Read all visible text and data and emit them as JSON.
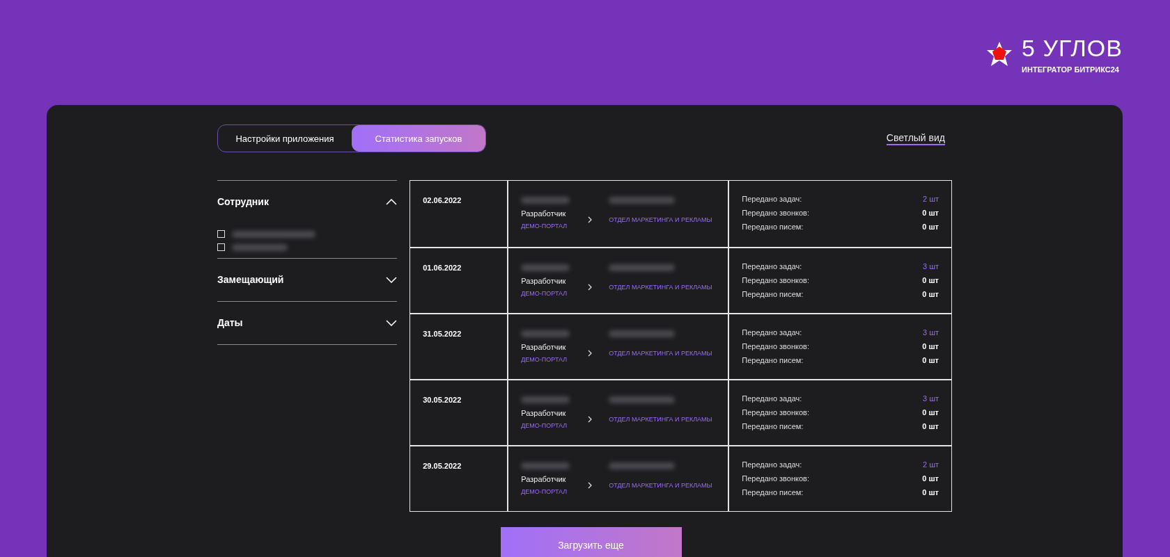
{
  "logo": {
    "title": "5 УГЛОВ",
    "subtitle": "ИНТЕГРАТОР БИТРИКС24"
  },
  "tabs": [
    {
      "label": "Настройки приложения",
      "selected": false
    },
    {
      "label": "Статистика запусков",
      "selected": true
    }
  ],
  "theme_link": "Светлый вид",
  "filters": [
    {
      "title": "Сотрудник",
      "expanded": true,
      "options": [
        {
          "checked": false
        },
        {
          "checked": false
        }
      ]
    },
    {
      "title": "Замещающий",
      "expanded": false
    },
    {
      "title": "Даты",
      "expanded": false
    }
  ],
  "rows": [
    {
      "date": "02.06.2022",
      "role": "Разработчик",
      "portal": "ДЕМО-ПОРТАЛ",
      "department": "ОТДЕЛ МАРКЕТИНГА И РЕКЛАМЫ",
      "stats": [
        {
          "label": "Передано задач:",
          "value": "2 шт",
          "highlighted": true
        },
        {
          "label": "Передано звонков:",
          "value": "0 шт",
          "highlighted": false
        },
        {
          "label": "Передано писем:",
          "value": "0 шт",
          "highlighted": false
        }
      ]
    },
    {
      "date": "01.06.2022",
      "role": "Разработчик",
      "portal": "ДЕМО-ПОРТАЛ",
      "department": "ОТДЕЛ МАРКЕТИНГА И РЕКЛАМЫ",
      "stats": [
        {
          "label": "Передано задач:",
          "value": "3 шт",
          "highlighted": true
        },
        {
          "label": "Передано звонков:",
          "value": "0 шт",
          "highlighted": false
        },
        {
          "label": "Передано писем:",
          "value": "0 шт",
          "highlighted": false
        }
      ]
    },
    {
      "date": "31.05.2022",
      "role": "Разработчик",
      "portal": "ДЕМО-ПОРТАЛ",
      "department": "ОТДЕЛ МАРКЕТИНГА И РЕКЛАМЫ",
      "stats": [
        {
          "label": "Передано задач:",
          "value": "3 шт",
          "highlighted": true
        },
        {
          "label": "Передано звонков:",
          "value": "0 шт",
          "highlighted": false
        },
        {
          "label": "Передано писем:",
          "value": "0 шт",
          "highlighted": false
        }
      ]
    },
    {
      "date": "30.05.2022",
      "role": "Разработчик",
      "portal": "ДЕМО-ПОРТАЛ",
      "department": "ОТДЕЛ МАРКЕТИНГА И РЕКЛАМЫ",
      "stats": [
        {
          "label": "Передано задач:",
          "value": "3 шт",
          "highlighted": true
        },
        {
          "label": "Передано звонков:",
          "value": "0 шт",
          "highlighted": false
        },
        {
          "label": "Передано писем:",
          "value": "0 шт",
          "highlighted": false
        }
      ]
    },
    {
      "date": "29.05.2022",
      "role": "Разработчик",
      "portal": "ДЕМО-ПОРТАЛ",
      "department": "ОТДЕЛ МАРКЕТИНГА И РЕКЛАМЫ",
      "stats": [
        {
          "label": "Передано задач:",
          "value": "2 шт",
          "highlighted": true
        },
        {
          "label": "Передано звонков:",
          "value": "0 шт",
          "highlighted": false
        },
        {
          "label": "Передано писем:",
          "value": "0 шт",
          "highlighted": false
        }
      ]
    }
  ],
  "load_more": "Загрузить еще"
}
